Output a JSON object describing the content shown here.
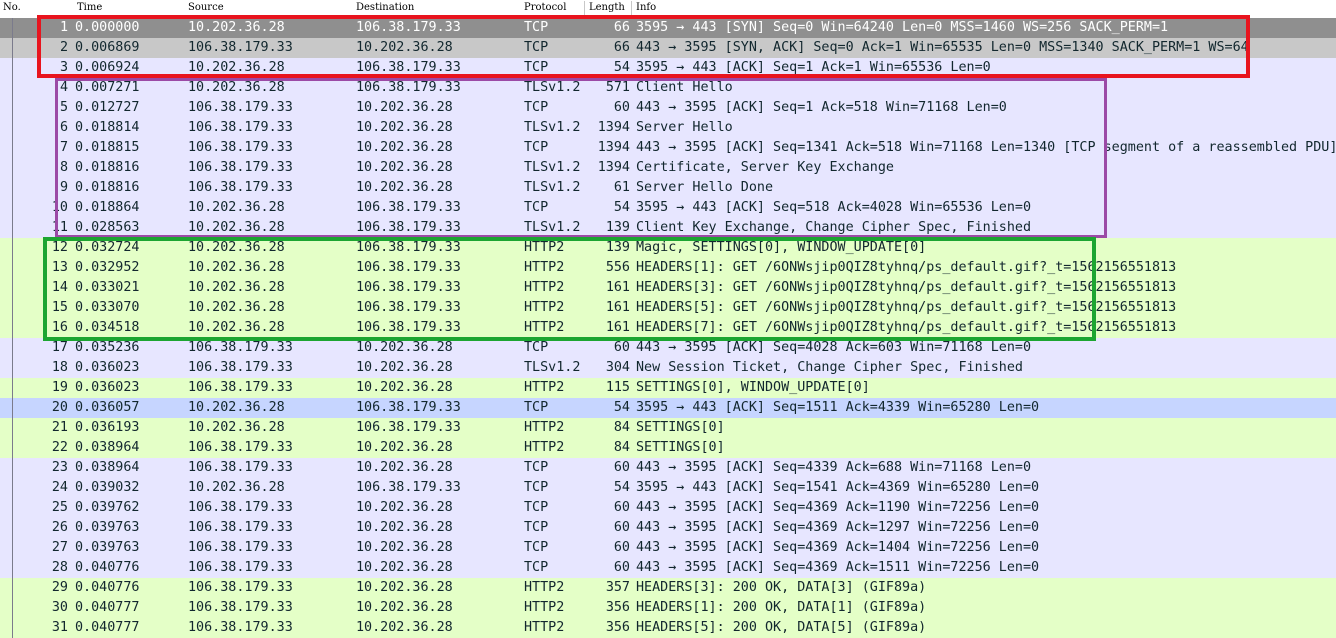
{
  "colors": {
    "tcp": "#e7e6ff",
    "http2": "#e4ffc7",
    "selected": "#8f8f8f",
    "related": "#c8c8c8",
    "ack_highlight": "#c6d5ff",
    "red_box": "#e8141e",
    "purple_box": "#9b4aa6",
    "green_box": "#1ca531"
  },
  "columns": {
    "no": "No.",
    "time": "Time",
    "source": "Source",
    "destination": "Destination",
    "protocol": "Protocol",
    "length": "Length",
    "info": "Info"
  },
  "packets": [
    {
      "no": "1",
      "time": "0.000000",
      "source": "10.202.36.28",
      "destination": "106.38.179.33",
      "protocol": "TCP",
      "length": "66",
      "info": "3595 → 443 [SYN] Seq=0 Win=64240 Len=0 MSS=1460 WS=256 SACK_PERM=1",
      "style": "selected"
    },
    {
      "no": "2",
      "time": "0.006869",
      "source": "106.38.179.33",
      "destination": "10.202.36.28",
      "protocol": "TCP",
      "length": "66",
      "info": "443 → 3595 [SYN, ACK] Seq=0 Ack=1 Win=65535 Len=0 MSS=1340 SACK_PERM=1 WS=64",
      "style": "related"
    },
    {
      "no": "3",
      "time": "0.006924",
      "source": "10.202.36.28",
      "destination": "106.38.179.33",
      "protocol": "TCP",
      "length": "54",
      "info": "3595 → 443 [ACK] Seq=1 Ack=1 Win=65536 Len=0",
      "style": "tcp"
    },
    {
      "no": "4",
      "time": "0.007271",
      "source": "10.202.36.28",
      "destination": "106.38.179.33",
      "protocol": "TLSv1.2",
      "length": "571",
      "info": "Client Hello",
      "style": "tcp"
    },
    {
      "no": "5",
      "time": "0.012727",
      "source": "106.38.179.33",
      "destination": "10.202.36.28",
      "protocol": "TCP",
      "length": "60",
      "info": "443 → 3595 [ACK] Seq=1 Ack=518 Win=71168 Len=0",
      "style": "tcp"
    },
    {
      "no": "6",
      "time": "0.018814",
      "source": "106.38.179.33",
      "destination": "10.202.36.28",
      "protocol": "TLSv1.2",
      "length": "1394",
      "info": "Server Hello",
      "style": "tcp"
    },
    {
      "no": "7",
      "time": "0.018815",
      "source": "106.38.179.33",
      "destination": "10.202.36.28",
      "protocol": "TCP",
      "length": "1394",
      "info": "443 → 3595 [ACK] Seq=1341 Ack=518 Win=71168 Len=1340 [TCP segment of a reassembled PDU]",
      "style": "tcp"
    },
    {
      "no": "8",
      "time": "0.018816",
      "source": "106.38.179.33",
      "destination": "10.202.36.28",
      "protocol": "TLSv1.2",
      "length": "1394",
      "info": "Certificate, Server Key Exchange",
      "style": "tcp"
    },
    {
      "no": "9",
      "time": "0.018816",
      "source": "106.38.179.33",
      "destination": "10.202.36.28",
      "protocol": "TLSv1.2",
      "length": "61",
      "info": "Server Hello Done",
      "style": "tcp"
    },
    {
      "no": "10",
      "time": "0.018864",
      "source": "10.202.36.28",
      "destination": "106.38.179.33",
      "protocol": "TCP",
      "length": "54",
      "info": "3595 → 443 [ACK] Seq=518 Ack=4028 Win=65536 Len=0",
      "style": "tcp"
    },
    {
      "no": "11",
      "time": "0.028563",
      "source": "10.202.36.28",
      "destination": "106.38.179.33",
      "protocol": "TLSv1.2",
      "length": "139",
      "info": "Client Key Exchange, Change Cipher Spec, Finished",
      "style": "tcp"
    },
    {
      "no": "12",
      "time": "0.032724",
      "source": "10.202.36.28",
      "destination": "106.38.179.33",
      "protocol": "HTTP2",
      "length": "139",
      "info": "Magic, SETTINGS[0], WINDOW_UPDATE[0]",
      "style": "http2"
    },
    {
      "no": "13",
      "time": "0.032952",
      "source": "10.202.36.28",
      "destination": "106.38.179.33",
      "protocol": "HTTP2",
      "length": "556",
      "info": "HEADERS[1]: GET /6ONWsjip0QIZ8tyhnq/ps_default.gif?_t=1562156551813",
      "style": "http2"
    },
    {
      "no": "14",
      "time": "0.033021",
      "source": "10.202.36.28",
      "destination": "106.38.179.33",
      "protocol": "HTTP2",
      "length": "161",
      "info": "HEADERS[3]: GET /6ONWsjip0QIZ8tyhnq/ps_default.gif?_t=1562156551813",
      "style": "http2"
    },
    {
      "no": "15",
      "time": "0.033070",
      "source": "10.202.36.28",
      "destination": "106.38.179.33",
      "protocol": "HTTP2",
      "length": "161",
      "info": "HEADERS[5]: GET /6ONWsjip0QIZ8tyhnq/ps_default.gif?_t=1562156551813",
      "style": "http2"
    },
    {
      "no": "16",
      "time": "0.034518",
      "source": "10.202.36.28",
      "destination": "106.38.179.33",
      "protocol": "HTTP2",
      "length": "161",
      "info": "HEADERS[7]: GET /6ONWsjip0QIZ8tyhnq/ps_default.gif?_t=1562156551813",
      "style": "http2"
    },
    {
      "no": "17",
      "time": "0.035236",
      "source": "106.38.179.33",
      "destination": "10.202.36.28",
      "protocol": "TCP",
      "length": "60",
      "info": "443 → 3595 [ACK] Seq=4028 Ack=603 Win=71168 Len=0",
      "style": "tcp"
    },
    {
      "no": "18",
      "time": "0.036023",
      "source": "106.38.179.33",
      "destination": "10.202.36.28",
      "protocol": "TLSv1.2",
      "length": "304",
      "info": "New Session Ticket, Change Cipher Spec, Finished",
      "style": "tcp"
    },
    {
      "no": "19",
      "time": "0.036023",
      "source": "106.38.179.33",
      "destination": "10.202.36.28",
      "protocol": "HTTP2",
      "length": "115",
      "info": "SETTINGS[0], WINDOW_UPDATE[0]",
      "style": "http2"
    },
    {
      "no": "20",
      "time": "0.036057",
      "source": "10.202.36.28",
      "destination": "106.38.179.33",
      "protocol": "TCP",
      "length": "54",
      "info": "3595 → 443 [ACK] Seq=1511 Ack=4339 Win=65280 Len=0",
      "style": "ack_highlight"
    },
    {
      "no": "21",
      "time": "0.036193",
      "source": "10.202.36.28",
      "destination": "106.38.179.33",
      "protocol": "HTTP2",
      "length": "84",
      "info": "SETTINGS[0]",
      "style": "http2"
    },
    {
      "no": "22",
      "time": "0.038964",
      "source": "106.38.179.33",
      "destination": "10.202.36.28",
      "protocol": "HTTP2",
      "length": "84",
      "info": "SETTINGS[0]",
      "style": "http2"
    },
    {
      "no": "23",
      "time": "0.038964",
      "source": "106.38.179.33",
      "destination": "10.202.36.28",
      "protocol": "TCP",
      "length": "60",
      "info": "443 → 3595 [ACK] Seq=4339 Ack=688 Win=71168 Len=0",
      "style": "tcp"
    },
    {
      "no": "24",
      "time": "0.039032",
      "source": "10.202.36.28",
      "destination": "106.38.179.33",
      "protocol": "TCP",
      "length": "54",
      "info": "3595 → 443 [ACK] Seq=1541 Ack=4369 Win=65280 Len=0",
      "style": "tcp"
    },
    {
      "no": "25",
      "time": "0.039762",
      "source": "106.38.179.33",
      "destination": "10.202.36.28",
      "protocol": "TCP",
      "length": "60",
      "info": "443 → 3595 [ACK] Seq=4369 Ack=1190 Win=72256 Len=0",
      "style": "tcp"
    },
    {
      "no": "26",
      "time": "0.039763",
      "source": "106.38.179.33",
      "destination": "10.202.36.28",
      "protocol": "TCP",
      "length": "60",
      "info": "443 → 3595 [ACK] Seq=4369 Ack=1297 Win=72256 Len=0",
      "style": "tcp"
    },
    {
      "no": "27",
      "time": "0.039763",
      "source": "106.38.179.33",
      "destination": "10.202.36.28",
      "protocol": "TCP",
      "length": "60",
      "info": "443 → 3595 [ACK] Seq=4369 Ack=1404 Win=72256 Len=0",
      "style": "tcp"
    },
    {
      "no": "28",
      "time": "0.040776",
      "source": "106.38.179.33",
      "destination": "10.202.36.28",
      "protocol": "TCP",
      "length": "60",
      "info": "443 → 3595 [ACK] Seq=4369 Ack=1511 Win=72256 Len=0",
      "style": "tcp"
    },
    {
      "no": "29",
      "time": "0.040776",
      "source": "106.38.179.33",
      "destination": "10.202.36.28",
      "protocol": "HTTP2",
      "length": "357",
      "info": "HEADERS[3]: 200 OK, DATA[3] (GIF89a)",
      "style": "http2"
    },
    {
      "no": "30",
      "time": "0.040777",
      "source": "106.38.179.33",
      "destination": "10.202.36.28",
      "protocol": "HTTP2",
      "length": "356",
      "info": "HEADERS[1]: 200 OK, DATA[1] (GIF89a)",
      "style": "http2"
    },
    {
      "no": "31",
      "time": "0.040777",
      "source": "106.38.179.33",
      "destination": "10.202.36.28",
      "protocol": "HTTP2",
      "length": "356",
      "info": "HEADERS[5]: 200 OK, DATA[5] (GIF89a)",
      "style": "http2"
    }
  ]
}
